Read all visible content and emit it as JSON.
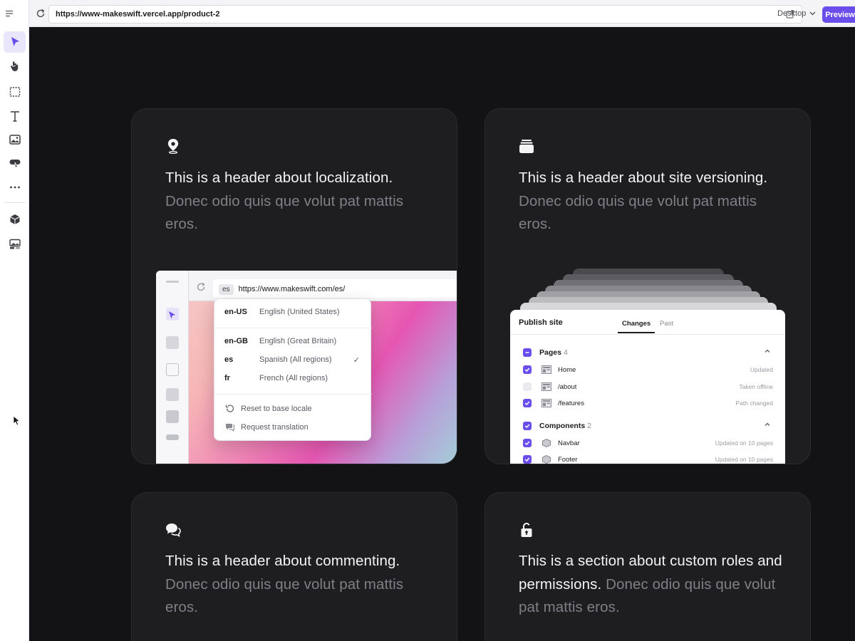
{
  "topbar": {
    "url": "https://www-makeswift.vercel.app/product-2",
    "device": "Desktop",
    "preview_label": "Preview"
  },
  "tools": [
    "select-tool",
    "hand-tool",
    "box-tool",
    "text-tool",
    "image-tool",
    "button-tool",
    "more-tool",
    "component-tool",
    "media-tool"
  ],
  "cards": [
    {
      "icon": "location-pin-icon",
      "heading_strong": "This is a header about localization.",
      "heading_muted": "Donec odio quis que volut pat mattis eros."
    },
    {
      "icon": "stack-icon",
      "heading_strong": "This is a header about site versioning.",
      "heading_muted": "Donec odio quis que volut pat mattis eros."
    },
    {
      "icon": "chat-bubbles-icon",
      "heading_strong": "This is a header about commenting.",
      "heading_muted": "Donec odio quis que volut pat mattis eros."
    },
    {
      "icon": "unlock-icon",
      "heading_strong": "This is a section about custom roles and permissions.",
      "heading_muted": "Donec odio quis que volut pat mattis eros."
    }
  ],
  "locale_mock": {
    "locale_chip": "es",
    "url": "https://www.makeswift.com/es/",
    "locales": [
      {
        "code": "en-US",
        "name": "English (United States)",
        "check": ""
      },
      {
        "code": "en-GB",
        "name": "English (Great Britain)",
        "check": ""
      },
      {
        "code": "es",
        "name": "Spanish (All regions)",
        "check": "✓"
      },
      {
        "code": "fr",
        "name": "French (All regions)",
        "check": ""
      }
    ],
    "actions": [
      "Reset to base locale",
      "Request translation"
    ]
  },
  "publish_mock": {
    "title": "Publish site",
    "tab_active": "Changes",
    "tab_other": "Past",
    "groups": {
      "pages": {
        "label": "Pages",
        "count": "4"
      },
      "components": {
        "label": "Components",
        "count": "2"
      }
    },
    "pages": [
      {
        "name": "Home",
        "status": "Updated",
        "checked": true
      },
      {
        "name": "/about",
        "status": "Taken offline",
        "checked": false
      },
      {
        "name": "/features",
        "status": "Path changed",
        "checked": true
      }
    ],
    "components": [
      {
        "name": "Navbar",
        "status": "Updated on 10 pages",
        "checked": true
      },
      {
        "name": "Footer",
        "status": "Updated on 10 pages",
        "checked": true
      }
    ]
  },
  "colors": {
    "accent": "#6a4dea",
    "canvas_bg": "#131316",
    "card_bg": "#1e1e21",
    "muted_text": "#7f7f86"
  }
}
